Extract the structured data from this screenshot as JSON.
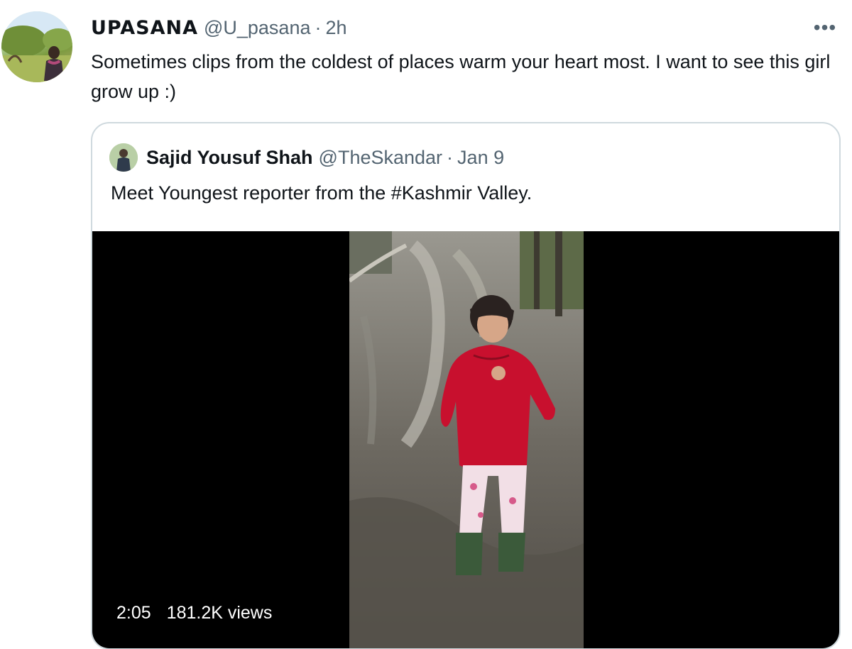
{
  "tweet": {
    "avatar_icon": "user-avatar-photo",
    "display_name": "UPASANA",
    "handle": "@U_pasana",
    "separator": "·",
    "time": "2h",
    "more_icon": "more-horizontal-icon",
    "more_glyph": "•••",
    "text": "Sometimes clips from the coldest of places warm your heart most. I want to see this girl grow up :)"
  },
  "quote": {
    "avatar_icon": "quoted-user-avatar-photo",
    "display_name": "Sajid Yousuf Shah",
    "handle": "@TheSkandar",
    "separator": "·",
    "time": "Jan 9",
    "text": "Meet Youngest reporter from the #Kashmir Valley.",
    "video": {
      "duration": "2:05",
      "views": "181.2K views"
    }
  },
  "colors": {
    "text_primary": "#0f1419",
    "text_secondary": "#536471",
    "card_border": "#cfd9de",
    "video_background": "#000000",
    "jacket_red": "#c8102e"
  }
}
